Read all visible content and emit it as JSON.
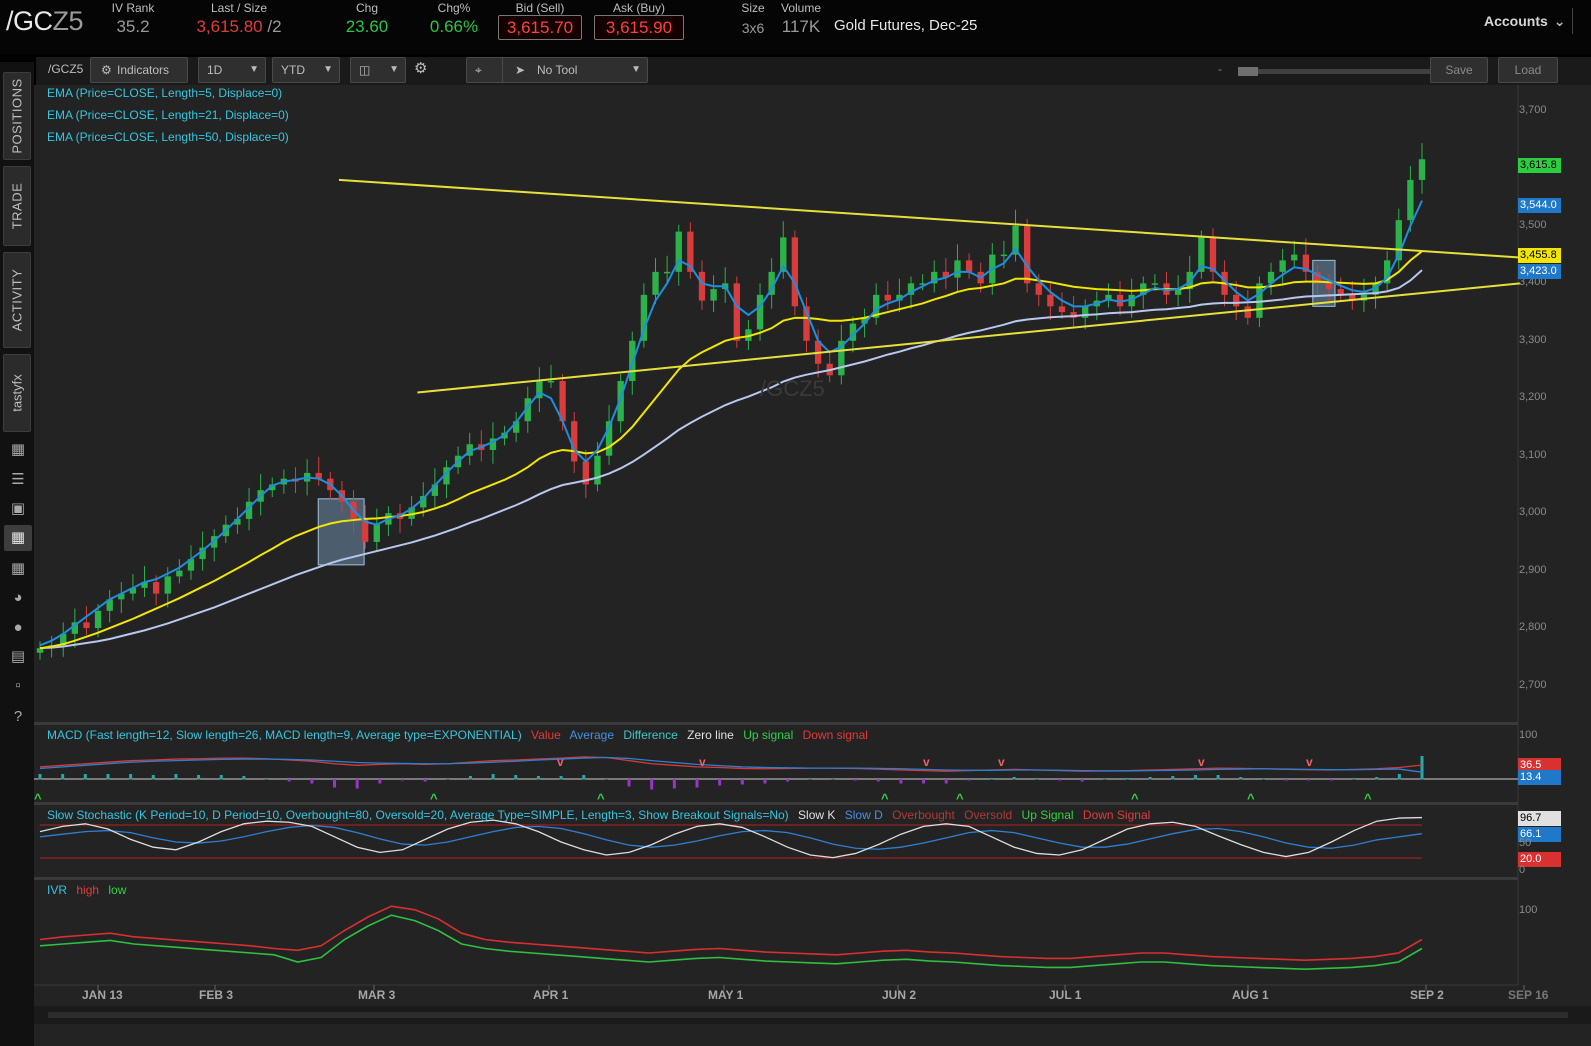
{
  "quote": {
    "symbol_main": "/GC",
    "symbol_suffix": "Z5",
    "iv_rank_label": "IV Rank",
    "iv_rank": "35.2",
    "last_label": "Last / Size",
    "last": "3,615.80",
    "last_size": "/2",
    "chg_label": "Chg",
    "chg": "23.60",
    "chgpct_label": "Chg%",
    "chgpct": "0.66%",
    "bid_label": "Bid (Sell)",
    "bid": "3,615.70",
    "ask_label": "Ask (Buy)",
    "ask": "3,615.90",
    "size_label": "Size",
    "size": "3x6",
    "volume_label": "Volume",
    "volume": "117K",
    "description": "Gold Futures, Dec-25",
    "accounts_label": "Accounts"
  },
  "left_tabs": [
    "POSITIONS",
    "TRADE",
    "ACTIVITY",
    "tastyfx"
  ],
  "left_icons": [
    "chart-panel-icon",
    "list-icon",
    "tv-icon",
    "chart-grid-icon",
    "layout-icon",
    "speedometer-icon",
    "community-icon",
    "calendar-icon",
    "news-icon",
    "help-icon"
  ],
  "toolbar": {
    "symbol": "/GCZ5",
    "indicators_label": "Indicators",
    "interval": "1D",
    "range": "YTD",
    "tool": "No Tool",
    "zoom_minus": "-",
    "zoom_plus": "+",
    "save_label": "Save",
    "load_label": "Load"
  },
  "ema_labels": [
    "EMA (Price=CLOSE, Length=5, Displace=0)",
    "EMA (Price=CLOSE, Length=21, Displace=0)",
    "EMA (Price=CLOSE, Length=50, Displace=0)"
  ],
  "watermark": "/GCZ5",
  "macd": {
    "title": "MACD (Fast length=12, Slow length=26, MACD length=9, Average type=EXPONENTIAL)",
    "legend": [
      "Value",
      "Average",
      "Difference",
      "Zero line",
      "Up signal",
      "Down signal"
    ],
    "ticks": [
      "100"
    ],
    "tags": [
      "36.5",
      "13.4"
    ]
  },
  "stoch": {
    "title": "Slow Stochastic (K Period=10, D Period=10, Overbought=80, Oversold=20, Average Type=SIMPLE, Length=3, Show Breakout Signals=No)",
    "legend": [
      "Slow K",
      "Slow D",
      "Overbought",
      "Oversold",
      "Up Signal",
      "Down Signal"
    ],
    "ticks": [
      "50",
      "0"
    ],
    "tags": [
      "96.7",
      "66.1",
      "20.0"
    ]
  },
  "ivr": {
    "title": "IVR",
    "legend": [
      "high",
      "low"
    ],
    "ticks": [
      "100"
    ]
  },
  "chart_data": {
    "type": "candlestick",
    "title": "/GCZ5",
    "x_labels": [
      "JAN 13",
      "FEB 3",
      "MAR 3",
      "APR 1",
      "MAY 1",
      "JUN 2",
      "JUL 1",
      "AUG 1",
      "SEP 2",
      "SEP 16"
    ],
    "y_ticks": [
      2700,
      2800,
      2900,
      3000,
      3100,
      3200,
      3300,
      3400,
      3500,
      3600,
      3700
    ],
    "ylim": [
      2640,
      3740
    ],
    "price_tags": {
      "last": 3615.8,
      "ema5": 3544.0,
      "ema21": 3455.8,
      "ema50": 3423.0
    },
    "close_series": [
      2765,
      2770,
      2790,
      2810,
      2800,
      2830,
      2850,
      2860,
      2870,
      2880,
      2860,
      2890,
      2900,
      2920,
      2940,
      2960,
      2980,
      2990,
      3020,
      3040,
      3050,
      3060,
      3055,
      3070,
      3060,
      3040,
      3020,
      2990,
      2950,
      2980,
      3000,
      2990,
      3010,
      3030,
      3050,
      3080,
      3100,
      3120,
      3110,
      3130,
      3140,
      3160,
      3200,
      3230,
      3230,
      3160,
      3090,
      3050,
      3100,
      3160,
      3230,
      3300,
      3380,
      3420,
      3420,
      3490,
      3420,
      3370,
      3390,
      3400,
      3300,
      3320,
      3380,
      3420,
      3480,
      3360,
      3300,
      3260,
      3240,
      3300,
      3330,
      3340,
      3380,
      3370,
      3380,
      3400,
      3400,
      3420,
      3410,
      3440,
      3420,
      3400,
      3450,
      3450,
      3500,
      3400,
      3380,
      3360,
      3350,
      3340,
      3360,
      3370,
      3380,
      3360,
      3380,
      3400,
      3400,
      3380,
      3390,
      3420,
      3480,
      3420,
      3380,
      3360,
      3340,
      3400,
      3420,
      3440,
      3450,
      3420,
      3400,
      3390,
      3380,
      3370,
      3380,
      3400,
      3440,
      3510,
      3580,
      3616
    ],
    "ema5": [
      2770,
      2778,
      2790,
      2805,
      2820,
      2835,
      2850,
      2860,
      2870,
      2880,
      2885,
      2895,
      2905,
      2920,
      2935,
      2952,
      2970,
      2990,
      3010,
      3030,
      3048,
      3055,
      3058,
      3062,
      3060,
      3050,
      3030,
      3005,
      2985,
      2980,
      2990,
      2996,
      3008,
      3025,
      3048,
      3070,
      3090,
      3108,
      3115,
      3124,
      3136,
      3158,
      3185,
      3210,
      3200,
      3160,
      3110,
      3090,
      3110,
      3150,
      3200,
      3260,
      3320,
      3370,
      3400,
      3440,
      3430,
      3400,
      3395,
      3395,
      3360,
      3345,
      3360,
      3390,
      3430,
      3400,
      3350,
      3300,
      3280,
      3290,
      3310,
      3330,
      3355,
      3365,
      3372,
      3385,
      3395,
      3405,
      3410,
      3420,
      3420,
      3410,
      3425,
      3435,
      3460,
      3430,
      3405,
      3385,
      3370,
      3360,
      3360,
      3365,
      3372,
      3368,
      3372,
      3382,
      3392,
      3388,
      3390,
      3402,
      3430,
      3425,
      3405,
      3385,
      3370,
      3382,
      3400,
      3415,
      3428,
      3425,
      3415,
      3405,
      3396,
      3388,
      3385,
      3392,
      3410,
      3450,
      3500,
      3544
    ],
    "ema21": [
      2765,
      2768,
      2772,
      2778,
      2785,
      2792,
      2800,
      2808,
      2816,
      2825,
      2834,
      2843,
      2852,
      2862,
      2872,
      2882,
      2893,
      2904,
      2915,
      2927,
      2938,
      2950,
      2960,
      2968,
      2976,
      2982,
      2986,
      2988,
      2990,
      2991,
      2993,
      2995,
      2998,
      3002,
      3008,
      3015,
      3024,
      3034,
      3042,
      3050,
      3058,
      3068,
      3080,
      3095,
      3105,
      3110,
      3108,
      3104,
      3106,
      3115,
      3130,
      3150,
      3175,
      3200,
      3225,
      3250,
      3268,
      3280,
      3290,
      3300,
      3305,
      3308,
      3314,
      3322,
      3335,
      3340,
      3340,
      3338,
      3335,
      3335,
      3337,
      3340,
      3345,
      3350,
      3355,
      3360,
      3365,
      3372,
      3378,
      3385,
      3390,
      3392,
      3396,
      3400,
      3408,
      3408,
      3405,
      3402,
      3398,
      3394,
      3392,
      3390,
      3389,
      3388,
      3387,
      3388,
      3390,
      3390,
      3390,
      3393,
      3400,
      3402,
      3400,
      3397,
      3393,
      3393,
      3395,
      3398,
      3402,
      3403,
      3403,
      3402,
      3401,
      3400,
      3399,
      3400,
      3406,
      3420,
      3440,
      3456
    ],
    "ema50": [
      2765,
      2766,
      2768,
      2771,
      2774,
      2777,
      2781,
      2786,
      2791,
      2796,
      2802,
      2808,
      2815,
      2822,
      2829,
      2836,
      2844,
      2852,
      2860,
      2868,
      2876,
      2884,
      2892,
      2899,
      2906,
      2913,
      2919,
      2924,
      2929,
      2934,
      2939,
      2944,
      2949,
      2955,
      2961,
      2968,
      2975,
      2983,
      2990,
      2998,
      3006,
      3014,
      3023,
      3033,
      3042,
      3049,
      3053,
      3057,
      3062,
      3069,
      3078,
      3089,
      3102,
      3116,
      3130,
      3145,
      3157,
      3168,
      3178,
      3188,
      3196,
      3203,
      3211,
      3219,
      3229,
      3236,
      3241,
      3245,
      3249,
      3254,
      3259,
      3264,
      3270,
      3276,
      3281,
      3287,
      3292,
      3298,
      3303,
      3309,
      3314,
      3318,
      3323,
      3328,
      3334,
      3337,
      3339,
      3341,
      3342,
      3343,
      3345,
      3346,
      3348,
      3349,
      3350,
      3352,
      3354,
      3355,
      3357,
      3359,
      3363,
      3365,
      3366,
      3366,
      3367,
      3368,
      3370,
      3372,
      3375,
      3377,
      3378,
      3379,
      3380,
      3381,
      3382,
      3383,
      3386,
      3392,
      3405,
      3423
    ],
    "trendlines": [
      {
        "name": "upper",
        "from": [
          0.202,
          3580
        ],
        "to": [
          1.0,
          3445
        ]
      },
      {
        "name": "lower",
        "from": [
          0.255,
          3210
        ],
        "to": [
          1.0,
          3400
        ]
      }
    ],
    "highlight_boxes": [
      {
        "x_from": 0.188,
        "x_to": 0.219,
        "y_from": 2910,
        "y_to": 3025
      },
      {
        "x_from": 0.86,
        "x_to": 0.875,
        "y_from": 3360,
        "y_to": 3440
      }
    ],
    "macd_value": [
      30,
      35,
      40,
      45,
      50,
      52,
      55,
      56,
      58,
      58,
      56,
      52,
      48,
      40,
      35,
      38,
      40,
      38,
      40,
      45,
      50,
      52,
      55,
      58,
      62,
      60,
      50,
      40,
      35,
      30,
      28,
      25,
      24,
      25,
      26,
      26,
      25,
      23,
      20,
      18,
      16,
      18,
      20,
      22,
      20,
      18,
      16,
      17,
      18,
      20,
      22,
      24,
      26,
      25,
      24,
      22,
      21,
      20,
      22,
      24,
      28,
      36
    ],
    "macd_avg": [
      25,
      30,
      35,
      40,
      45,
      48,
      50,
      52,
      54,
      55,
      55,
      54,
      52,
      48,
      44,
      42,
      41,
      40,
      40,
      42,
      45,
      48,
      52,
      55,
      58,
      60,
      57,
      50,
      44,
      38,
      34,
      30,
      28,
      27,
      26,
      26,
      26,
      25,
      24,
      22,
      20,
      19,
      19,
      20,
      20,
      19,
      18,
      17,
      17,
      18,
      19,
      20,
      22,
      23,
      24,
      23,
      22,
      21,
      21,
      22,
      23,
      13
    ],
    "stoch_k": [
      70,
      80,
      85,
      75,
      55,
      40,
      35,
      50,
      70,
      85,
      90,
      88,
      80,
      60,
      40,
      30,
      35,
      55,
      75,
      88,
      92,
      85,
      70,
      50,
      35,
      25,
      30,
      45,
      65,
      80,
      85,
      78,
      60,
      40,
      25,
      20,
      28,
      45,
      65,
      80,
      85,
      80,
      60,
      40,
      28,
      25,
      35,
      55,
      75,
      85,
      88,
      80,
      62,
      45,
      30,
      22,
      30,
      50,
      72,
      90,
      96,
      97
    ],
    "stoch_d": [
      60,
      65,
      70,
      72,
      68,
      58,
      50,
      48,
      52,
      60,
      70,
      78,
      82,
      78,
      68,
      56,
      46,
      44,
      50,
      60,
      70,
      78,
      80,
      76,
      66,
      54,
      44,
      40,
      44,
      52,
      62,
      70,
      72,
      68,
      58,
      46,
      38,
      36,
      40,
      48,
      58,
      68,
      72,
      68,
      58,
      48,
      40,
      40,
      46,
      56,
      66,
      74,
      76,
      70,
      60,
      48,
      40,
      38,
      44,
      54,
      60,
      66
    ],
    "ivr_high": [
      45,
      48,
      50,
      52,
      48,
      46,
      44,
      42,
      40,
      38,
      35,
      33,
      38,
      55,
      70,
      82,
      78,
      68,
      52,
      45,
      42,
      40,
      38,
      36,
      34,
      32,
      30,
      32,
      34,
      35,
      33,
      31,
      30,
      29,
      28,
      30,
      32,
      33,
      31,
      30,
      28,
      26,
      25,
      24,
      24,
      26,
      28,
      30,
      30,
      28,
      26,
      25,
      24,
      23,
      22,
      23,
      24,
      26,
      30,
      45
    ],
    "ivr_low": [
      38,
      40,
      42,
      44,
      40,
      38,
      36,
      34,
      32,
      30,
      28,
      20,
      25,
      45,
      60,
      72,
      66,
      55,
      40,
      35,
      32,
      30,
      28,
      26,
      24,
      22,
      20,
      22,
      24,
      25,
      23,
      21,
      20,
      19,
      18,
      20,
      22,
      23,
      21,
      20,
      18,
      16,
      15,
      14,
      14,
      16,
      18,
      20,
      20,
      18,
      16,
      15,
      14,
      13,
      12,
      13,
      14,
      16,
      20,
      35
    ]
  }
}
